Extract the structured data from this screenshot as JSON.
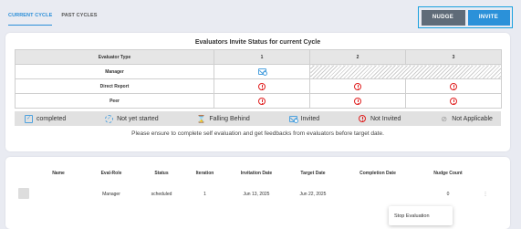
{
  "tabs": [
    {
      "label": "CURRENT CYCLE",
      "active": true
    },
    {
      "label": "PAST CYCLES",
      "active": false
    }
  ],
  "actions": {
    "nudge": "NUDGE",
    "invite": "INVITE"
  },
  "status_panel": {
    "title": "Evaluators Invite Status for current Cycle",
    "columns": [
      "Evaluator Type",
      "1",
      "2",
      "3"
    ],
    "rows": [
      {
        "type": "Manager",
        "cells": [
          "invited-icon",
          "not-applicable",
          "",
          ""
        ]
      },
      {
        "type": "Direct Report",
        "cells": [
          "not-invited-icon",
          "not-invited-icon",
          "not-invited-icon"
        ]
      },
      {
        "type": "Peer",
        "cells": [
          "not-invited-icon",
          "not-invited-icon",
          "not-invited-icon"
        ]
      }
    ],
    "legend": [
      {
        "label": "completed",
        "icon": "completed-icon"
      },
      {
        "label": "Not yet started",
        "icon": "not-started-icon"
      },
      {
        "label": "Falling Behind",
        "icon": "hourglass-icon"
      },
      {
        "label": "Invited",
        "icon": "invited-icon"
      },
      {
        "label": "Not Invited",
        "icon": "not-invited-icon"
      },
      {
        "label": "Not Applicable",
        "icon": "not-applicable-icon"
      }
    ],
    "note": "Please ensure to complete self evaluation and get feedbacks from evaluators before target date."
  },
  "evaluators": {
    "columns": [
      "Name",
      "Eval-Role",
      "Status",
      "Iteration",
      "Invitation Date",
      "Target Date",
      "Completion Date",
      "Nudge Count"
    ],
    "rows": [
      {
        "name": "",
        "role": "Manager",
        "status": "scheduled",
        "iteration": "1",
        "invitation_date": "Jun 13, 2025",
        "target_date": "Jun 22, 2025",
        "completion_date": "",
        "nudge_count": "0"
      }
    ]
  },
  "context_menu": {
    "items": [
      "Stop Evaluation"
    ]
  },
  "colors": {
    "accent": "#2b91d9",
    "nudge": "#5f6b78",
    "not_invited": "#e02020",
    "invited": "#4ea2df"
  }
}
